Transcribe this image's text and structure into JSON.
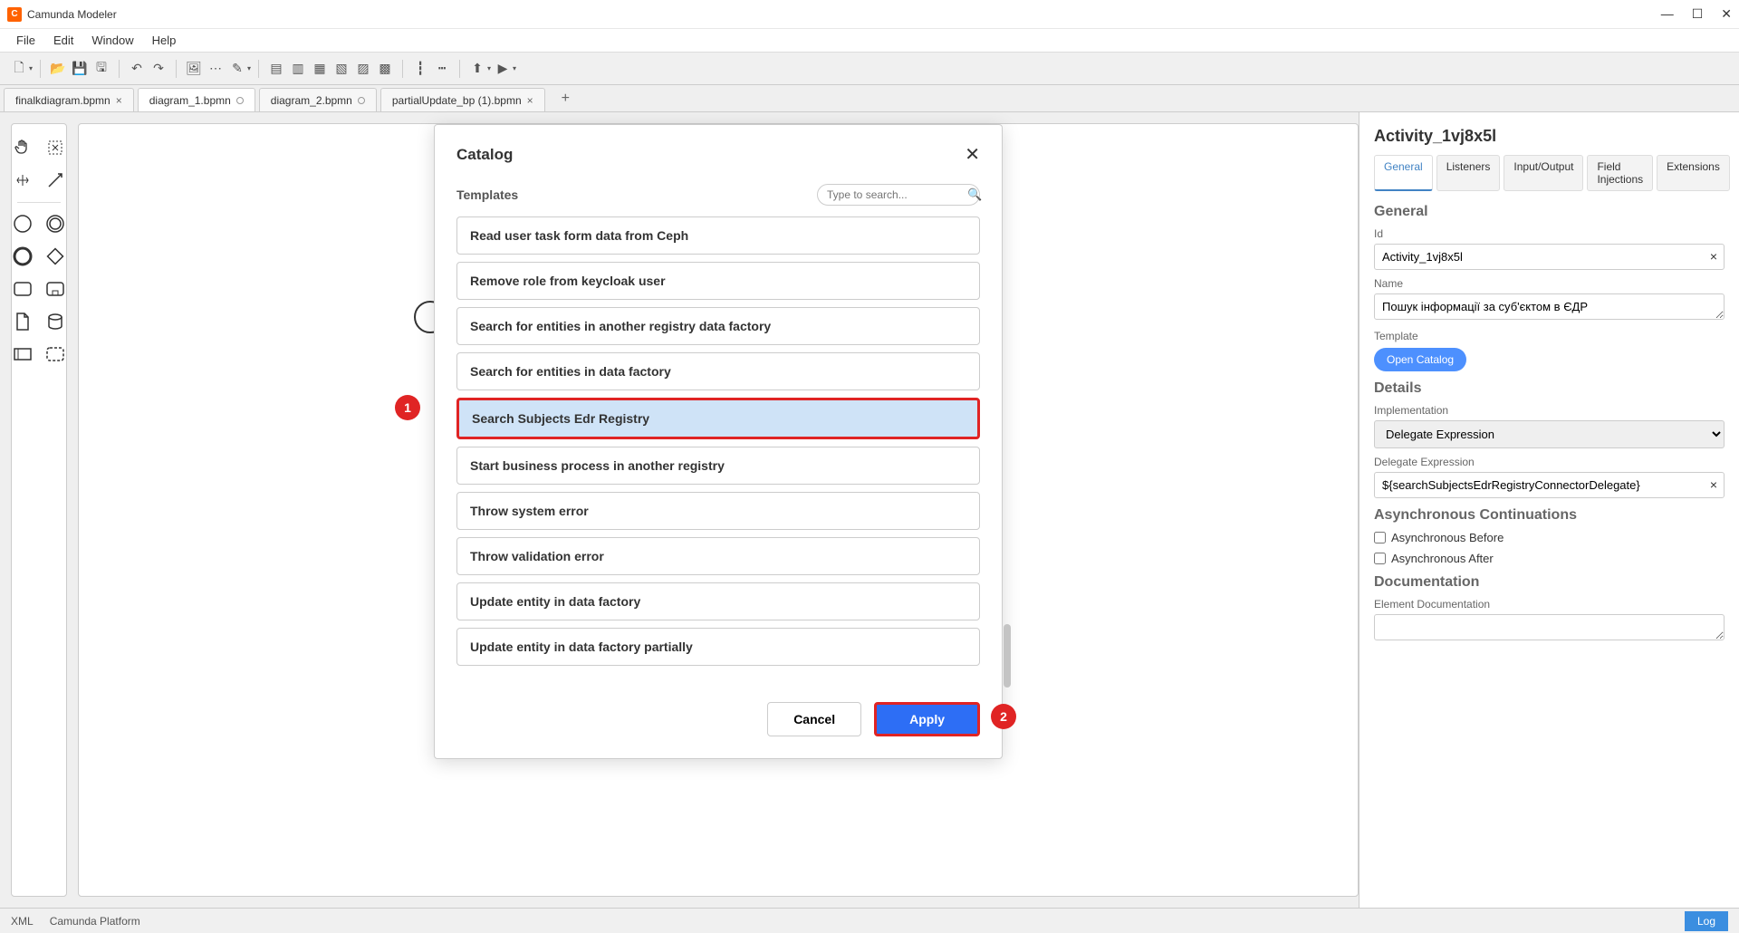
{
  "titlebar": {
    "app_name": "Camunda Modeler"
  },
  "menubar": {
    "items": [
      "File",
      "Edit",
      "Window",
      "Help"
    ]
  },
  "tabs": [
    {
      "label": "finalkdiagram.bpmn",
      "close": true,
      "active": false
    },
    {
      "label": "diagram_1.bpmn",
      "dirty": true,
      "active": true
    },
    {
      "label": "diagram_2.bpmn",
      "dirty": true,
      "active": false
    },
    {
      "label": "partialUpdate_bp (1).bpmn",
      "close": true,
      "active": false
    }
  ],
  "modal": {
    "title": "Catalog",
    "templates_label": "Templates",
    "search_placeholder": "Type to search...",
    "items": [
      {
        "label": "Read user task form data from Ceph"
      },
      {
        "label": "Remove role from keycloak user"
      },
      {
        "label": "Search for entities in another registry data factory"
      },
      {
        "label": "Search for entities in data factory"
      },
      {
        "label": "Search Subjects Edr Registry",
        "selected": true
      },
      {
        "label": "Start business process in another registry"
      },
      {
        "label": "Throw system error"
      },
      {
        "label": "Throw validation error"
      },
      {
        "label": "Update entity in data factory"
      },
      {
        "label": "Update entity in data factory partially"
      }
    ],
    "cancel_label": "Cancel",
    "apply_label": "Apply"
  },
  "annotations": {
    "badge1": "1",
    "badge2": "2"
  },
  "props": {
    "title": "Activity_1vj8x5l",
    "tabs": [
      "General",
      "Listeners",
      "Input/Output",
      "Field Injections",
      "Extensions"
    ],
    "section_general": "General",
    "id_label": "Id",
    "id_value": "Activity_1vj8x5l",
    "name_label": "Name",
    "name_value": "Пошук інформації за суб'єктом в ЄДР",
    "template_label": "Template",
    "open_catalog": "Open Catalog",
    "section_details": "Details",
    "implementation_label": "Implementation",
    "implementation_value": "Delegate Expression",
    "delegate_label": "Delegate Expression",
    "delegate_value": "${searchSubjectsEdrRegistryConnectorDelegate}",
    "section_async": "Asynchronous Continuations",
    "async_before": "Asynchronous Before",
    "async_after": "Asynchronous After",
    "section_doc": "Documentation",
    "eldoc_label": "Element Documentation"
  },
  "statusbar": {
    "left1": "XML",
    "left2": "Camunda Platform",
    "log": "Log"
  }
}
